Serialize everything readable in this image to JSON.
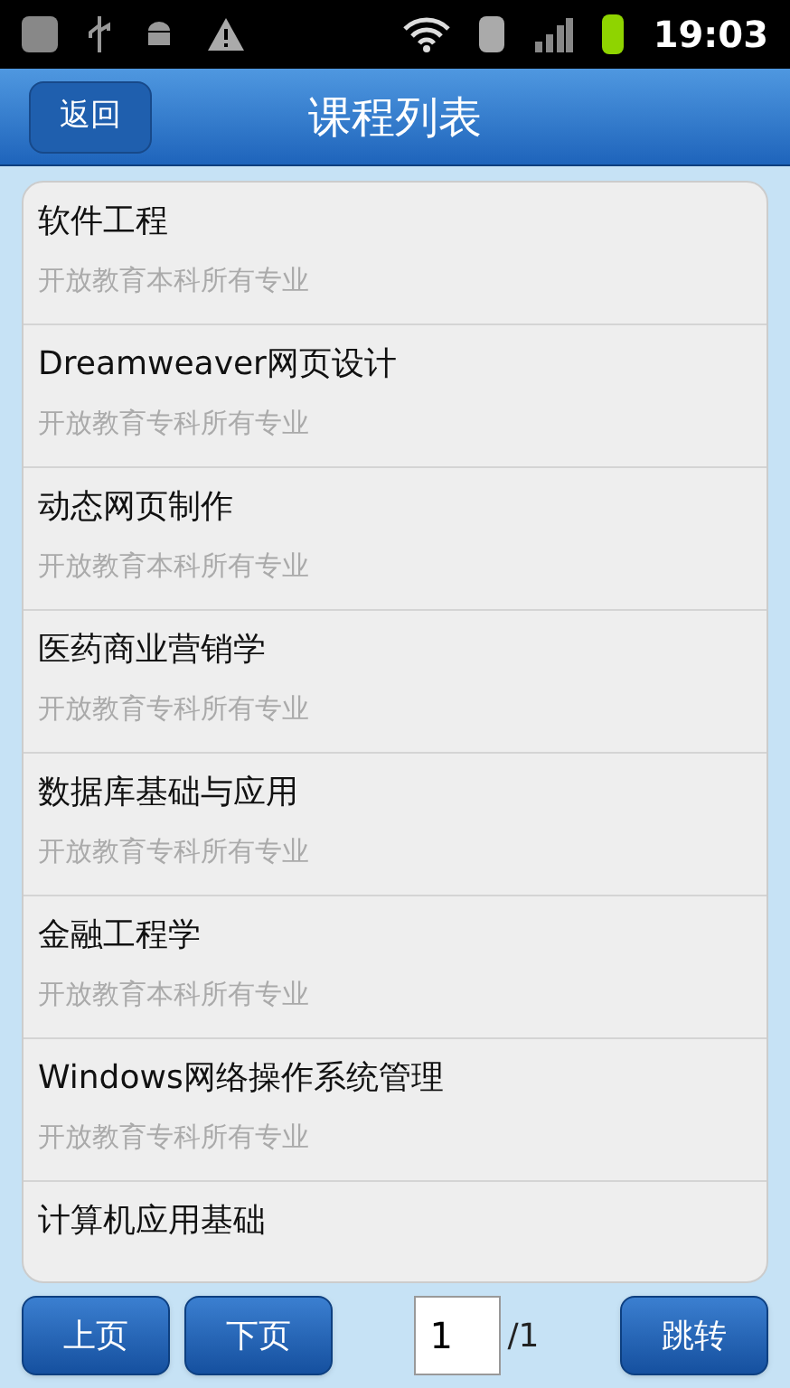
{
  "status_bar": {
    "time": "19:03"
  },
  "header": {
    "back": "返回",
    "title": "课程列表"
  },
  "courses": [
    {
      "title": "软件工程",
      "subtitle": "开放教育本科所有专业"
    },
    {
      "title": "Dreamweaver网页设计",
      "subtitle": "开放教育专科所有专业"
    },
    {
      "title": "动态网页制作",
      "subtitle": "开放教育本科所有专业"
    },
    {
      "title": "医药商业营销学",
      "subtitle": "开放教育专科所有专业"
    },
    {
      "title": "数据库基础与应用",
      "subtitle": "开放教育专科所有专业"
    },
    {
      "title": "金融工程学",
      "subtitle": "开放教育本科所有专业"
    },
    {
      "title": "Windows网络操作系统管理",
      "subtitle": "开放教育专科所有专业"
    },
    {
      "title": "计算机应用基础"
    }
  ],
  "pager": {
    "prev": "上页",
    "next": "下页",
    "page": "1",
    "total": "/1",
    "go": "跳转"
  }
}
